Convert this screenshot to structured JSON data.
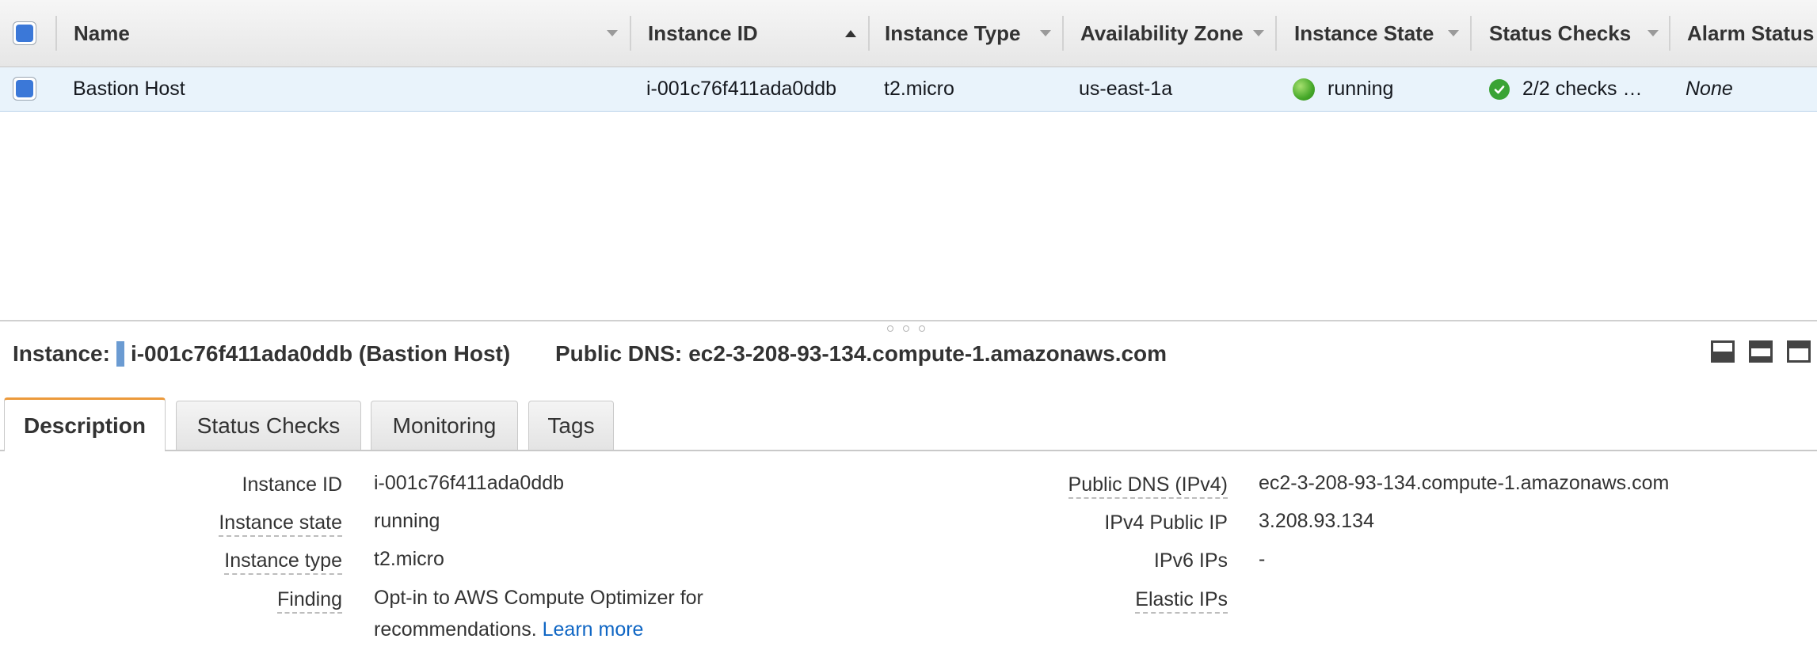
{
  "table": {
    "columns": [
      {
        "label": "Name"
      },
      {
        "label": "Instance ID"
      },
      {
        "label": "Instance Type"
      },
      {
        "label": "Availability Zone"
      },
      {
        "label": "Instance State"
      },
      {
        "label": "Status Checks"
      },
      {
        "label": "Alarm Status"
      }
    ],
    "rows": [
      {
        "name": "Bastion Host",
        "instance_id": "i-001c76f411ada0ddb",
        "instance_type": "t2.micro",
        "availability_zone": "us-east-1a",
        "instance_state": "running",
        "status_checks": "2/2 checks …",
        "alarm_status": "None"
      }
    ]
  },
  "detail": {
    "instance_label": "Instance:",
    "instance_value": "i-001c76f411ada0ddb (Bastion Host)",
    "public_dns_label": "Public DNS:",
    "public_dns_value": "ec2-3-208-93-134.compute-1.amazonaws.com",
    "tabs": [
      {
        "label": "Description",
        "active": true
      },
      {
        "label": "Status Checks",
        "active": false
      },
      {
        "label": "Monitoring",
        "active": false
      },
      {
        "label": "Tags",
        "active": false
      }
    ],
    "left_fields": [
      {
        "label": "Instance ID",
        "value": "i-001c76f411ada0ddb"
      },
      {
        "label": "Instance state",
        "value": "running"
      },
      {
        "label": "Instance type",
        "value": "t2.micro"
      },
      {
        "label": "Finding",
        "value_line1": "Opt-in to AWS Compute Optimizer for",
        "value_line2": "recommendations.",
        "link": "Learn more"
      }
    ],
    "right_fields": [
      {
        "label": "Public DNS (IPv4)",
        "value": "ec2-3-208-93-134.compute-1.amazonaws.com"
      },
      {
        "label": "IPv4 Public IP",
        "value": "3.208.93.134"
      },
      {
        "label": "IPv6 IPs",
        "value": "-"
      },
      {
        "label": "Elastic IPs",
        "value": ""
      }
    ]
  },
  "colors": {
    "selected_row": "#e9f3fb",
    "checkbox_blue": "#3b78d8",
    "active_tab_accent": "#ec9a3c",
    "running_green": "#46a829",
    "link_blue": "#0f66c4"
  },
  "icons": {
    "select_all": "checkbox-checked-icon",
    "state": "green-dot-icon",
    "status": "check-circle-icon",
    "panel_layouts": [
      "panel-bottom-icon",
      "panel-middle-icon",
      "panel-top-icon"
    ]
  }
}
